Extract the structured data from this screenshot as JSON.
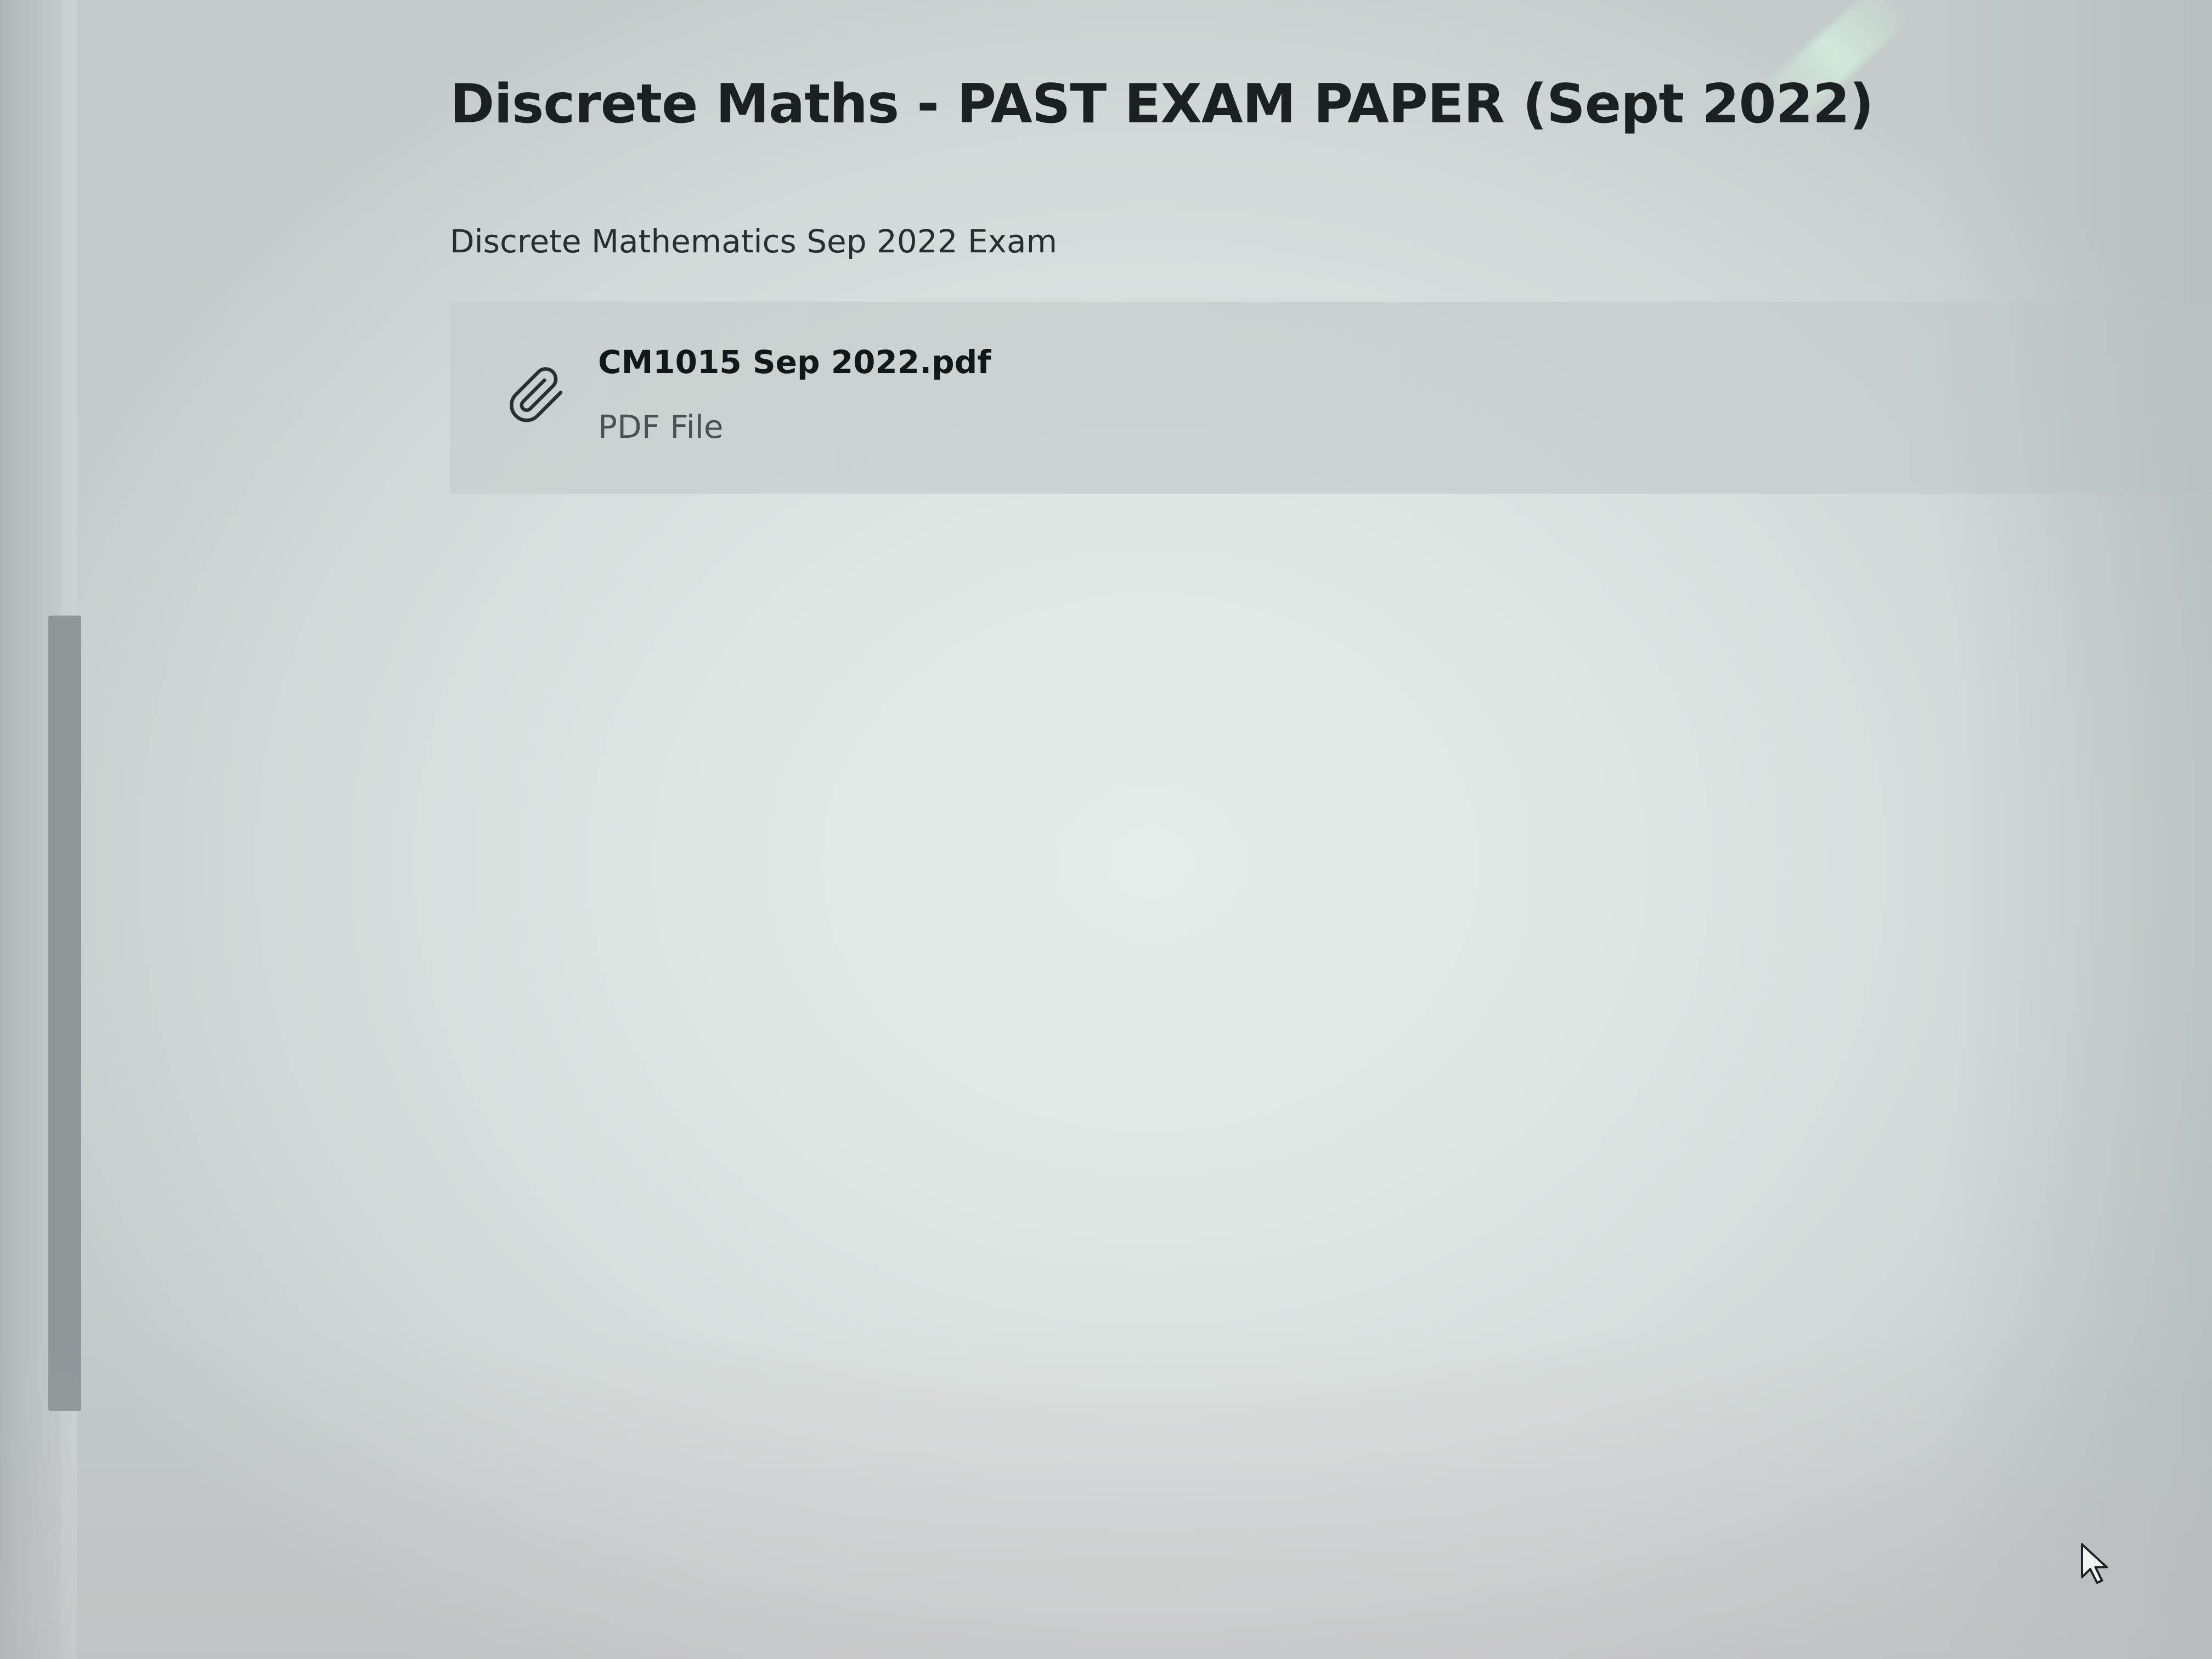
{
  "page": {
    "title": "Discrete Maths - PAST EXAM PAPER (Sept 2022)",
    "description": "Discrete Mathematics Sep 2022 Exam"
  },
  "attachment": {
    "icon": "paperclip-icon",
    "file_name": "CM1015 Sep 2022.pdf",
    "file_type": "PDF File"
  },
  "colors": {
    "background": "#dfe5e3",
    "card": "#c8cecd",
    "title_text": "#1d2022",
    "muted_text": "#4c5154",
    "scroll_thumb": "#8e9698"
  }
}
